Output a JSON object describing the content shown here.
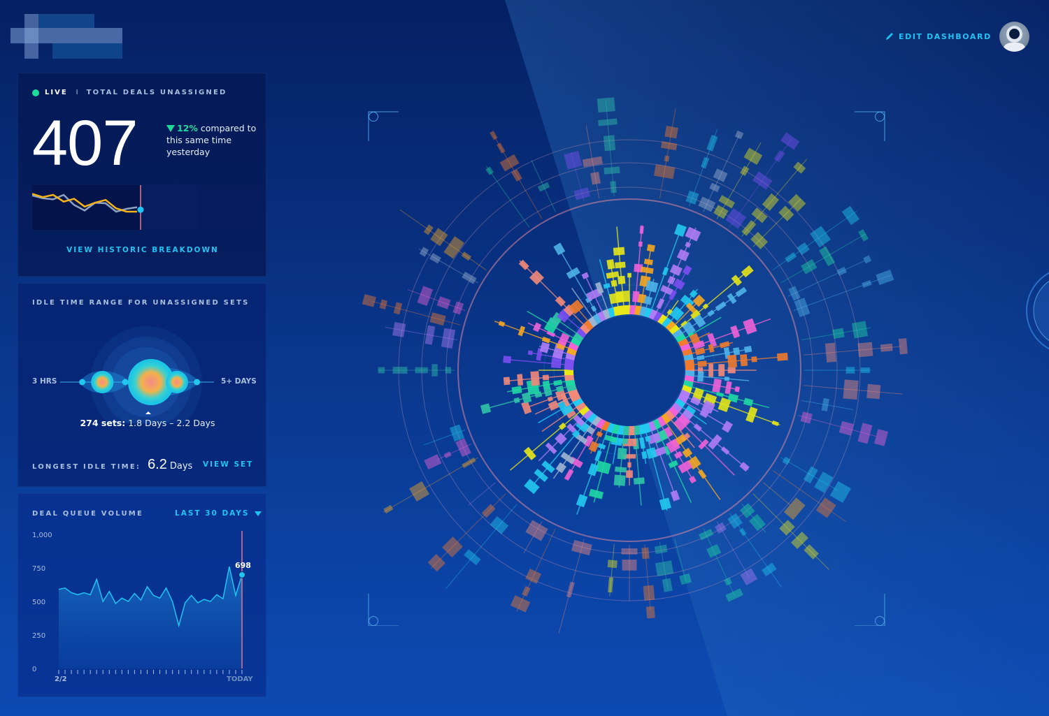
{
  "header": {
    "logo_label": "Company logo (pixelated)",
    "edit_dashboard_label": "EDIT DASHBOARD",
    "edit_icon": "pencil-icon",
    "avatar_icon": "astronaut-avatar"
  },
  "colors": {
    "accent": "#21c3f0",
    "live": "#1ddc9a",
    "orange": "#f5b31a",
    "gray_line": "#8da3c2",
    "marker_line": "#e07a8a",
    "background_top": "#052063",
    "background_bottom": "#0c4bb4"
  },
  "unassigned": {
    "live_label": "LIVE",
    "separator": "I",
    "title": "TOTAL DEALS UNASSIGNED",
    "count": "407",
    "change_pct": "12%",
    "change_direction": "down",
    "change_text_1": "compared",
    "change_text_2": "to this same time yesterday",
    "link_label": "VIEW HISTORIC BREAKDOWN",
    "sparkline": {
      "today": [
        0.72,
        0.66,
        0.7,
        0.58,
        0.63,
        0.49,
        0.56,
        0.61,
        0.46,
        0.4,
        0.4
      ],
      "yesterday": [
        0.69,
        0.64,
        0.62,
        0.7,
        0.52,
        0.42,
        0.56,
        0.55,
        0.4,
        0.45,
        0.48
      ],
      "current_marker_fraction": 0.45
    }
  },
  "idle": {
    "title": "IDLE TIME RANGE FOR UNASSIGNED SETS",
    "min_label": "3 HRS",
    "max_label": "5+ DAYS",
    "selected_count": "274 sets:",
    "selected_range": "1.8 Days – 2.2 Days",
    "longest_label": "LONGEST IDLE TIME:",
    "longest_value": "6.2",
    "longest_unit": "Days",
    "link_label": "VIEW SET",
    "bubbles": [
      {
        "position": 0.12,
        "size": "small-dot"
      },
      {
        "position": 0.26,
        "size": "medium"
      },
      {
        "position": 0.42,
        "size": "small-dot"
      },
      {
        "position": 0.6,
        "size": "large",
        "selected": true
      },
      {
        "position": 0.78,
        "size": "medium"
      },
      {
        "position": 0.92,
        "size": "small-dot"
      }
    ]
  },
  "queue": {
    "title": "DEAL QUEUE VOLUME",
    "range_label": "LAST 30 DAYS",
    "current_value": "698",
    "x_start_label": "2/2",
    "x_end_label": "TODAY",
    "chart_data": {
      "type": "area",
      "title": "DEAL QUEUE VOLUME",
      "xlabel": "",
      "ylabel": "",
      "ylim": [
        0,
        1000
      ],
      "yticks": [
        "0",
        "250",
        "500",
        "750",
        "1,000"
      ],
      "ytick_values": [
        0,
        250,
        500,
        750,
        1000
      ],
      "x_labels": [
        "2/2",
        "TODAY"
      ],
      "values": [
        590,
        600,
        565,
        550,
        565,
        550,
        665,
        500,
        575,
        485,
        525,
        500,
        560,
        510,
        610,
        545,
        525,
        600,
        500,
        320,
        490,
        545,
        490,
        515,
        500,
        550,
        520,
        760,
        545,
        698
      ],
      "highlight": {
        "index": 29,
        "label": "698"
      }
    }
  },
  "radial": {
    "description": "Radial multi-ring bar chart of unassigned deals",
    "spokes": 72,
    "seed": 7,
    "palette": [
      "#f062d8",
      "#f5a623",
      "#22c9f0",
      "#1fd8a4",
      "#b07cf5",
      "#f28a7a",
      "#e6e619",
      "#7b4ff0",
      "#9fb4d0",
      "#f07a2e",
      "#4fb3e8",
      "#2fc4a8"
    ]
  }
}
